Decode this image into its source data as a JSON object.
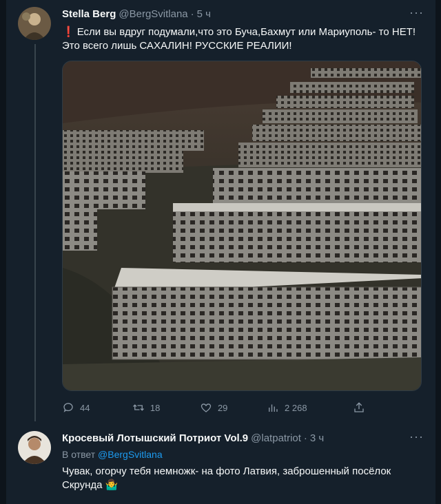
{
  "tweet1": {
    "name": "Stella Berg",
    "handle": "@BergSvitlana",
    "dot": "·",
    "time": "5 ч",
    "more": "···",
    "line1": "Если вы вдруг подумали,что это Буча,Бахмут или Мариуполь- то НЕТ!",
    "line2": "Это всего лишь САХАЛИН! РУССКИЕ РЕАЛИИ!",
    "mark": "❗"
  },
  "actions": {
    "replies": "44",
    "retweets": "18",
    "likes": "29",
    "views": "2 268"
  },
  "tweet2": {
    "name": "Кросевый Лотышский Потриот Vol.9",
    "handle": "@latpatriot",
    "dot": "·",
    "time": "3 ч",
    "more": "···",
    "reply_prefix": "В ответ",
    "reply_handle": "@BergSvitlana",
    "line1": "Чувак, огорчу тебя немножк- на фото Латвия, заброшенный посёлок",
    "line2": "Скрунда",
    "emoji": "🤷‍♂️"
  },
  "colors": {
    "background": "#15202b",
    "accent": "#1d9bf0",
    "muted": "#8b98a5"
  }
}
